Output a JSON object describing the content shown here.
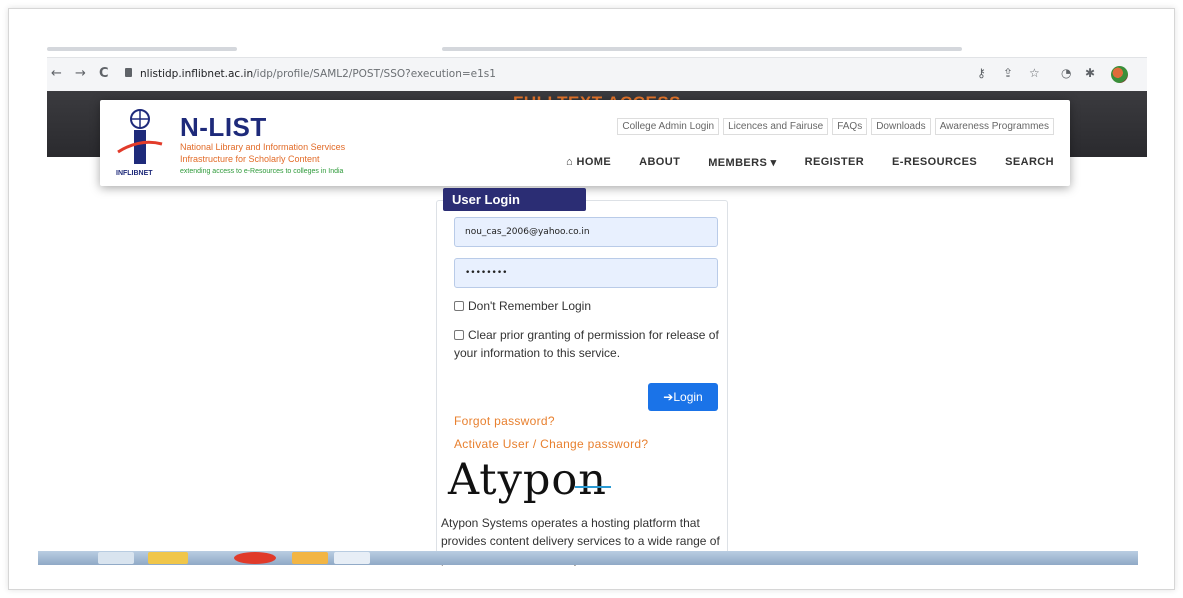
{
  "browser": {
    "url_host": "nlistidp.inflibnet.ac.in",
    "url_path": "/idp/profile/SAML2/POST/SSO?execution=e1s1",
    "back_icon": "←",
    "forward_icon": "→",
    "reload_icon": "C",
    "key_icon": "key-icon",
    "share_icon": "share-icon",
    "star_icon": "☆",
    "extensions_icon": "puzzle-icon"
  },
  "page_banner": "FULLTEXT ACCESS",
  "brand": {
    "title": "N-LIST",
    "subtitle_line1": "National Library and Information Services",
    "subtitle_line2": "Infrastructure for Scholarly Content",
    "tagline": "extending access to e-Resources to colleges in India",
    "logo_text": "INFLIBNET"
  },
  "top_links": [
    "College Admin Login",
    "Licences and Fairuse",
    "FAQs",
    "Downloads",
    "Awareness Programmes"
  ],
  "main_nav": [
    {
      "label": "HOME",
      "icon": "home-icon"
    },
    {
      "label": "ABOUT"
    },
    {
      "label": "MEMBERS ▾"
    },
    {
      "label": "REGISTER"
    },
    {
      "label": "E-RESOURCES"
    },
    {
      "label": "SEARCH"
    }
  ],
  "login": {
    "tab_title": "User Login",
    "username_value": "nou_cas_2006@yahoo.co.in",
    "password_value": "••••••••",
    "dont_remember_label": "Don't Remember Login",
    "clear_permission_label": "Clear prior granting of permission for release of your information to this service.",
    "login_button": "Login",
    "forgot_password": "Forgot password?",
    "activate_user": "Activate User / Change password?"
  },
  "provider": {
    "logo_text": "Atypon",
    "description": "Atypon Systems operates a hosting platform that provides content delivery services to a wide range of professional and scholarly"
  },
  "colors": {
    "accent_orange": "#e8762b",
    "brand_navy": "#1e2a7a",
    "login_tab": "#2b2d74",
    "login_button": "#1a73e8",
    "link": "#e8802f"
  }
}
